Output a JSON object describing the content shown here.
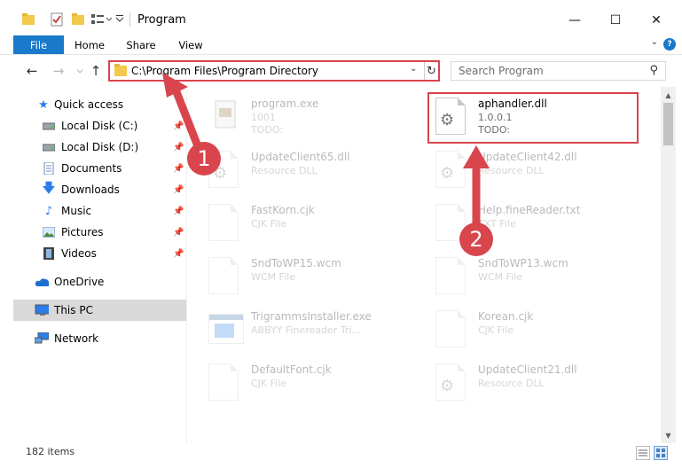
{
  "window": {
    "title": "Program",
    "controls": {
      "minimize": "—",
      "maximize": "☐",
      "close": "✕"
    }
  },
  "ribbon": {
    "tabs": [
      "File",
      "Home",
      "Share",
      "View"
    ]
  },
  "address": {
    "path": "C:\\Program Files\\Program Directory"
  },
  "search": {
    "placeholder": "Search Program"
  },
  "nav": {
    "items": [
      {
        "label": "Quick access",
        "icon": "star-icon"
      },
      {
        "label": "Local Disk (C:)",
        "icon": "drive-icon",
        "pinned": true
      },
      {
        "label": "Local Disk (D:)",
        "icon": "drive-icon",
        "pinned": true
      },
      {
        "label": "Documents",
        "icon": "documents-icon",
        "pinned": true
      },
      {
        "label": "Downloads",
        "icon": "download-icon",
        "pinned": true
      },
      {
        "label": "Music",
        "icon": "music-icon",
        "pinned": true
      },
      {
        "label": "Pictures",
        "icon": "pictures-icon",
        "pinned": true
      },
      {
        "label": "Videos",
        "icon": "videos-icon",
        "pinned": true
      },
      {
        "label": "OneDrive",
        "icon": "cloud-icon"
      },
      {
        "label": "This PC",
        "icon": "computer-icon",
        "selected": true
      },
      {
        "label": "Network",
        "icon": "network-icon"
      }
    ]
  },
  "files": [
    {
      "name": "program.exe",
      "line1": "1001",
      "line2": "TODO:",
      "faded": true
    },
    {
      "name": "aphandler.dll",
      "line1": "1.0.0.1",
      "line2": "TODO:",
      "faded": false
    },
    {
      "name": "UpdateClient65.dll",
      "line1": "Resource DLL",
      "faded": true
    },
    {
      "name": "UpdateClient42.dll",
      "line1": "Resource DLL",
      "faded": true
    },
    {
      "name": "FastKorn.cjk",
      "line1": "CJK File",
      "faded": true
    },
    {
      "name": "Help.fineReader.txt",
      "line1": "TXT File",
      "faded": true
    },
    {
      "name": "SndToWP15.wcm",
      "line1": "WCM File",
      "faded": true
    },
    {
      "name": "SndToWP13.wcm",
      "line1": "WCM File",
      "faded": true
    },
    {
      "name": "TrigrammsInstaller.exe",
      "line1": "ABBYY Finereader Tri...",
      "faded": true
    },
    {
      "name": "Korean.cjk",
      "line1": "CJK File",
      "faded": true
    },
    {
      "name": "DefaultFont.cjk",
      "line1": "CJK File",
      "faded": true
    },
    {
      "name": "UpdateClient21.dll",
      "line1": "Resource DLL",
      "faded": true
    }
  ],
  "status": {
    "count": "182 items"
  },
  "annotations": {
    "badge1": "1",
    "badge2": "2",
    "color": "#d9454d"
  }
}
